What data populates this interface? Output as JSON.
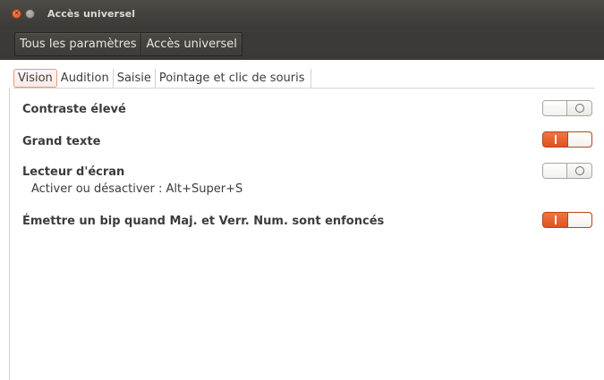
{
  "window": {
    "title": "Accès universel"
  },
  "breadcrumb": {
    "items": [
      {
        "label": "Tous les paramètres"
      },
      {
        "label": "Accès universel"
      }
    ]
  },
  "tabs": [
    {
      "label": "Vision",
      "active": true
    },
    {
      "label": "Audition",
      "active": false
    },
    {
      "label": "Saisie",
      "active": false
    },
    {
      "label": "Pointage et clic de souris",
      "active": false
    }
  ],
  "settings": [
    {
      "label": "Contraste élevé",
      "state": "off"
    },
    {
      "label": "Grand texte",
      "state": "on"
    },
    {
      "label": "Lecteur d'écran",
      "state": "off",
      "hint": "Activer ou désactiver : Alt+Super+S"
    },
    {
      "label": "Émettre un bip quand Maj. et Verr. Num. sont enfoncés",
      "state": "on"
    }
  ],
  "colors": {
    "accent": "#e2571f",
    "titlebar": "#3c3b37",
    "active_tab_border": "#e59a7f"
  }
}
